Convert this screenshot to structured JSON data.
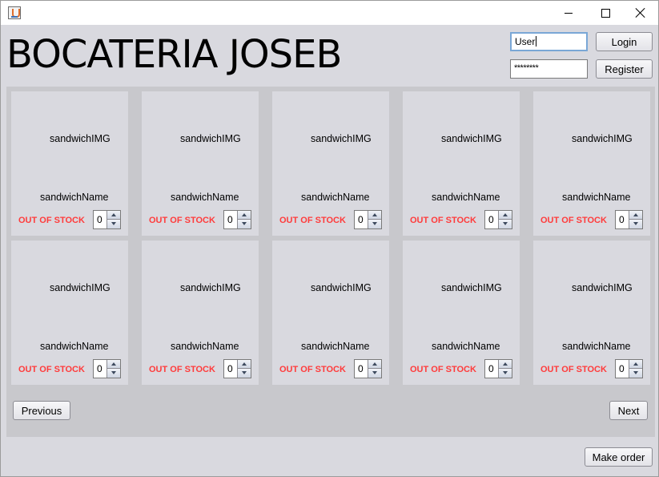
{
  "window": {
    "title": "",
    "controls": {
      "minimize": "minimize-icon",
      "maximize": "maximize-icon",
      "close": "close-icon"
    }
  },
  "header": {
    "app_title": "BOCATERIA JOSEB"
  },
  "auth": {
    "username_value": "User",
    "password_mask": "********",
    "login_label": "Login",
    "register_label": "Register"
  },
  "catalog": {
    "items": [
      {
        "image_label": "sandwichIMG",
        "name": "sandwichName",
        "stock_status": "OUT OF STOCK",
        "quantity": "0"
      },
      {
        "image_label": "sandwichIMG",
        "name": "sandwichName",
        "stock_status": "OUT OF STOCK",
        "quantity": "0"
      },
      {
        "image_label": "sandwichIMG",
        "name": "sandwichName",
        "stock_status": "OUT OF STOCK",
        "quantity": "0"
      },
      {
        "image_label": "sandwichIMG",
        "name": "sandwichName",
        "stock_status": "OUT OF STOCK",
        "quantity": "0"
      },
      {
        "image_label": "sandwichIMG",
        "name": "sandwichName",
        "stock_status": "OUT OF STOCK",
        "quantity": "0"
      },
      {
        "image_label": "sandwichIMG",
        "name": "sandwichName",
        "stock_status": "OUT OF STOCK",
        "quantity": "0"
      },
      {
        "image_label": "sandwichIMG",
        "name": "sandwichName",
        "stock_status": "OUT OF STOCK",
        "quantity": "0"
      },
      {
        "image_label": "sandwichIMG",
        "name": "sandwichName",
        "stock_status": "OUT OF STOCK",
        "quantity": "0"
      },
      {
        "image_label": "sandwichIMG",
        "name": "sandwichName",
        "stock_status": "OUT OF STOCK",
        "quantity": "0"
      },
      {
        "image_label": "sandwichIMG",
        "name": "sandwichName",
        "stock_status": "OUT OF STOCK",
        "quantity": "0"
      }
    ],
    "previous_label": "Previous",
    "next_label": "Next"
  },
  "footer": {
    "make_order_label": "Make order"
  },
  "colors": {
    "window_bg": "#d9d9df",
    "catalog_bg": "#c8c8cc",
    "out_of_stock": "#ff3b3b"
  }
}
